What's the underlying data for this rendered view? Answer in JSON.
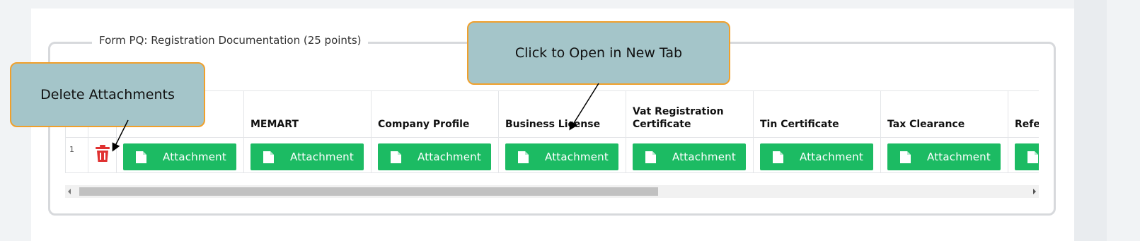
{
  "form": {
    "legend": "Form PQ: Registration Documentation (25 points)"
  },
  "table": {
    "headers": [
      "MEMART",
      "Company Profile",
      "Business License",
      "Vat Registration Certificate",
      "Tin Certificate",
      "Tax Clearance",
      "Refe"
    ],
    "row_number": "1",
    "attachment_label": "Attachment"
  },
  "callouts": {
    "delete": "Delete Attachments",
    "open": "Click to Open in New Tab"
  },
  "colors": {
    "button_green": "#1cbb63",
    "trash_red": "#e03131",
    "callout_fill": "#a4c5c9",
    "callout_border": "#f0a02c"
  },
  "icons": {
    "trash": "trash-icon",
    "document": "document-icon"
  }
}
